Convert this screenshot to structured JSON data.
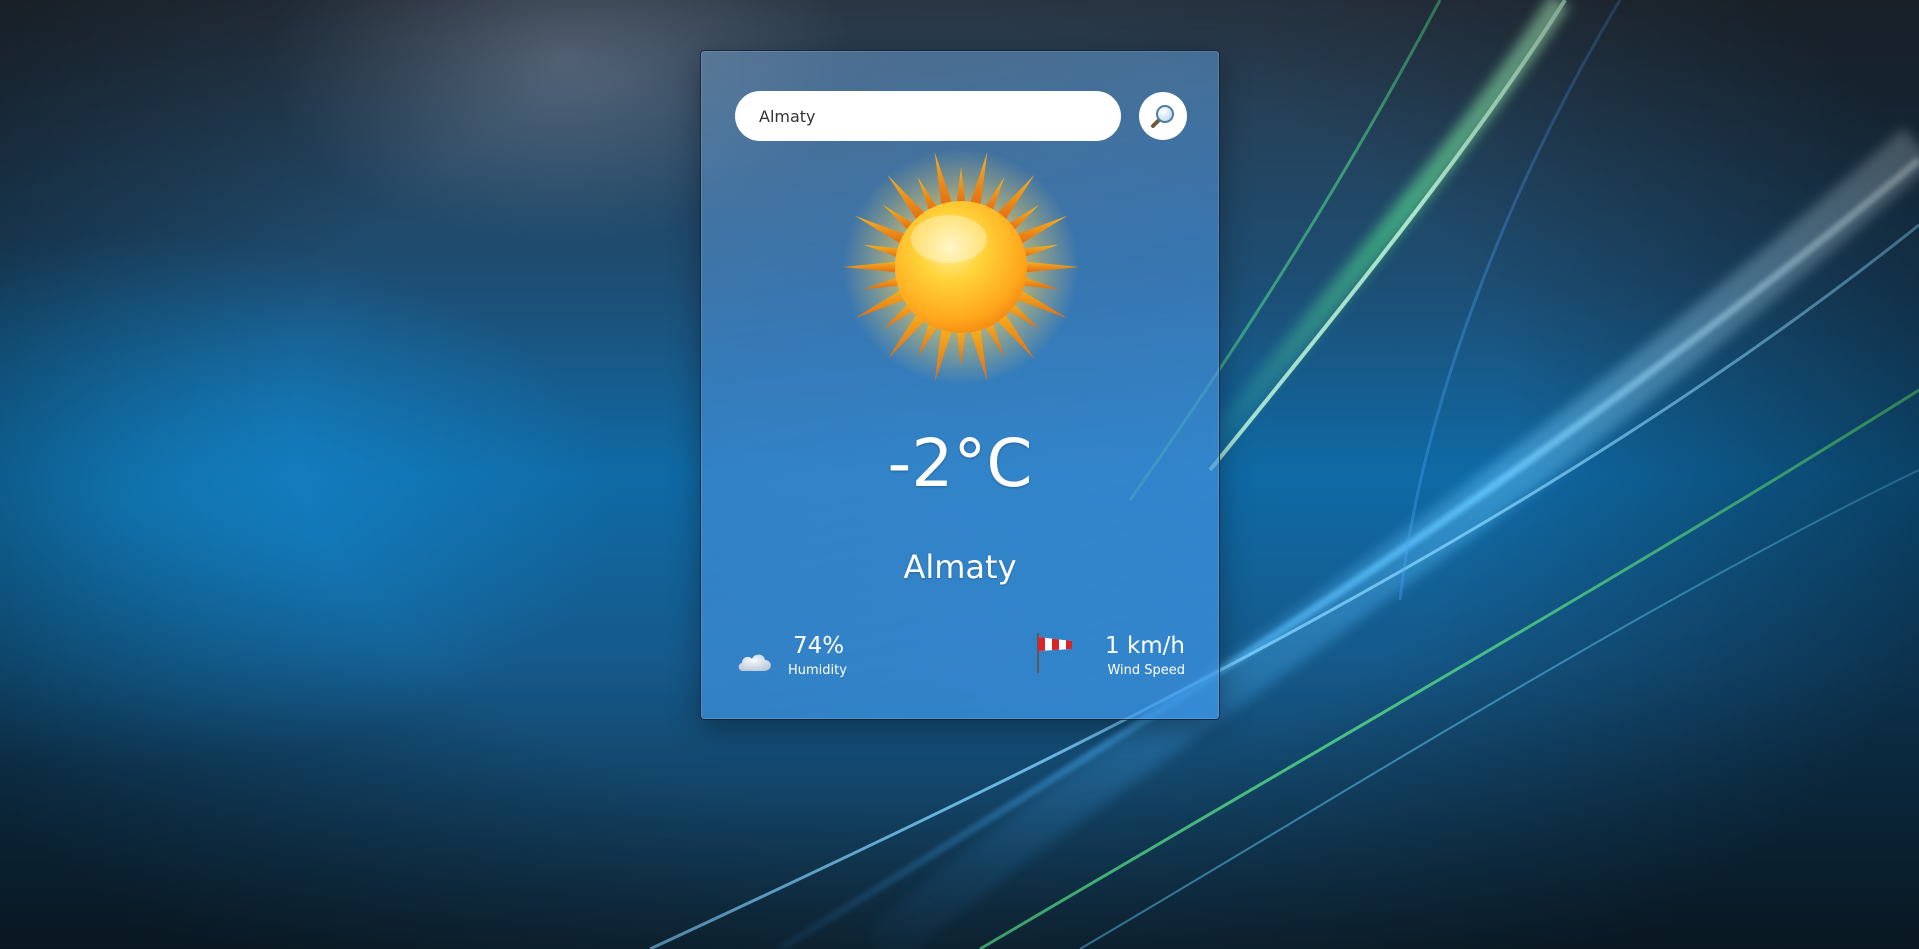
{
  "search": {
    "value": "Almaty",
    "placeholder": ""
  },
  "weather": {
    "condition_icon": "sun-icon",
    "temperature": "-2°C",
    "city": "Almaty"
  },
  "details": {
    "humidity": {
      "icon": "cloud-icon",
      "value": "74%",
      "label": "Humidity"
    },
    "wind": {
      "icon": "windsock-icon",
      "value": "1 km/h",
      "label": "Wind Speed"
    }
  },
  "colors": {
    "sun_core": "#ffb020",
    "sun_rays": "#f28c1a",
    "card_tint": "#4a8fd0"
  }
}
